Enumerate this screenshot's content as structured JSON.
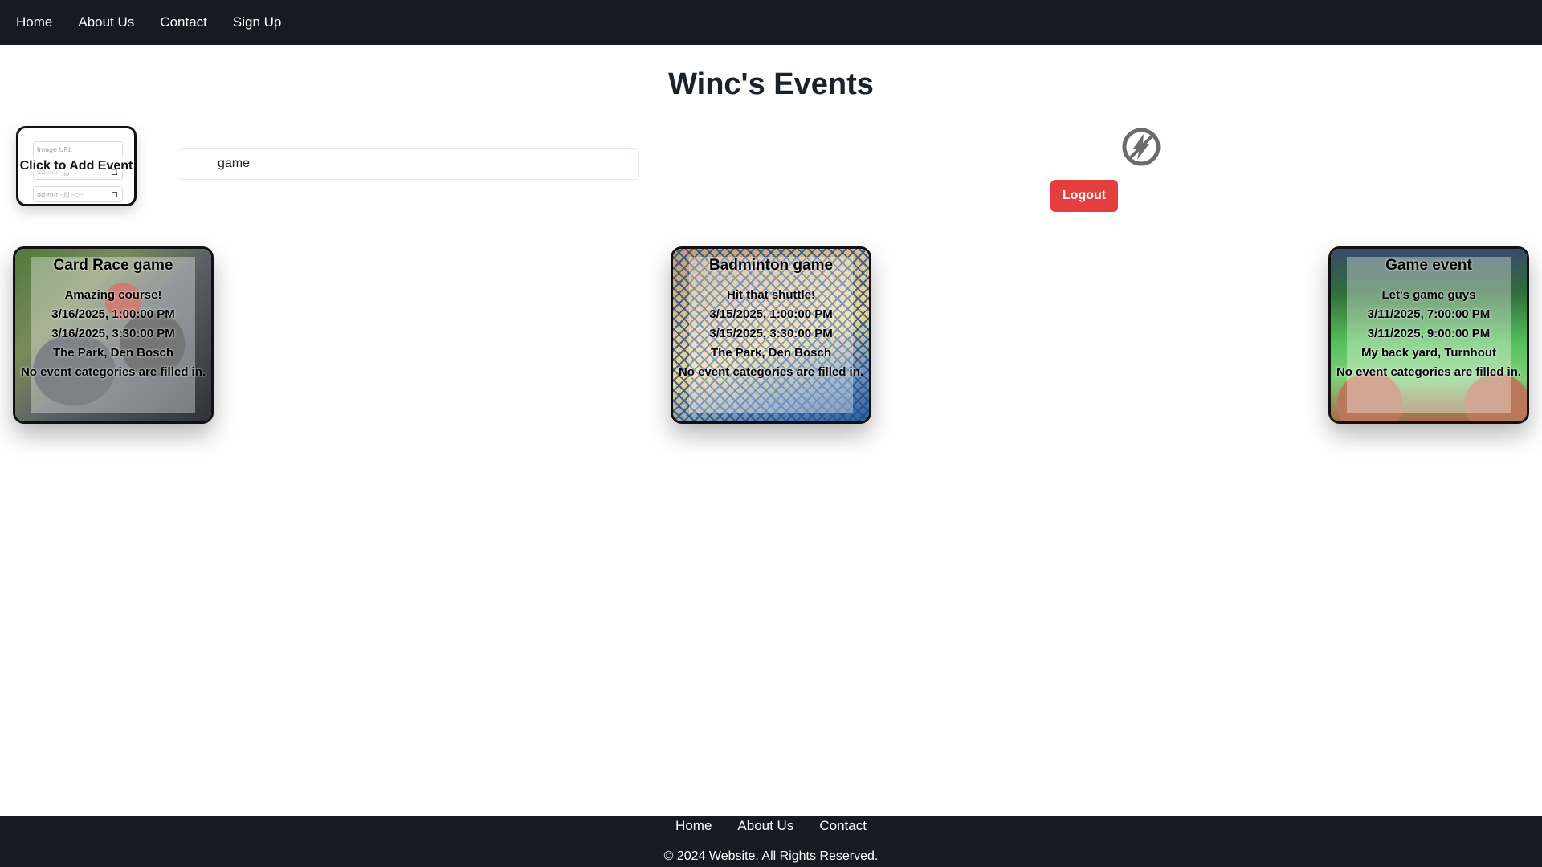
{
  "nav": {
    "items": [
      {
        "label": "Home"
      },
      {
        "label": "About Us"
      },
      {
        "label": "Contact"
      },
      {
        "label": "Sign Up"
      }
    ]
  },
  "page": {
    "title": "Winc's Events"
  },
  "add_event": {
    "label": "Click to Add Event",
    "ghost_fields": [
      "Image URL",
      "dd-mm-jjjj",
      "dd-mm-jjjj --:--"
    ]
  },
  "search": {
    "value": "game"
  },
  "header_actions": {
    "icon": "bolt-off-icon",
    "logout_label": "Logout",
    "logout_color": "#e53e3e"
  },
  "events": [
    {
      "title": "Card Race game",
      "description": "Amazing course!",
      "start": "3/16/2025, 1:00:00 PM",
      "end": "3/16/2025, 3:30:00 PM",
      "location": "The Park, Den Bosch",
      "categories": "No event categories are filled in."
    },
    {
      "title": "Badminton game",
      "description": "Hit that shuttle!",
      "start": "3/15/2025, 1:00:00 PM",
      "end": "3/15/2025, 3:30:00 PM",
      "location": "The Park, Den Bosch",
      "categories": "No event categories are filled in."
    },
    {
      "title": "Game event",
      "description": "Let's game guys",
      "start": "3/11/2025, 7:00:00 PM",
      "end": "3/11/2025, 9:00:00 PM",
      "location": "My back yard, Turnhout",
      "categories": "No event categories are filled in."
    }
  ],
  "footer": {
    "links": [
      {
        "label": "Home"
      },
      {
        "label": "About Us"
      },
      {
        "label": "Contact"
      }
    ],
    "copyright": "© 2024 Website. All Rights Reserved."
  },
  "colors": {
    "nav_bg": "#171923",
    "title": "#1a202c",
    "card_border": "#111111"
  }
}
